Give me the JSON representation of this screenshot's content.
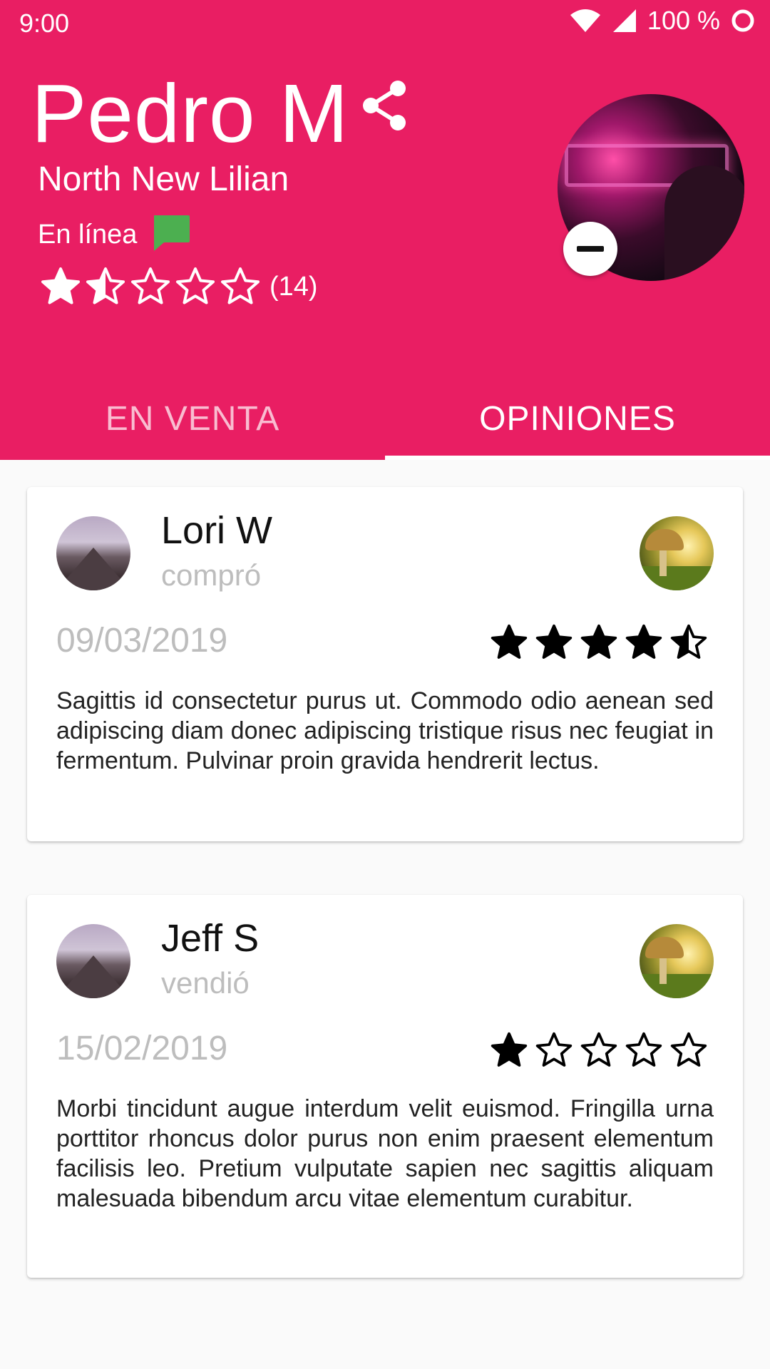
{
  "status_bar": {
    "time": "9:00",
    "battery_text": "100 %",
    "icons": [
      "wifi-icon",
      "cell-signal-icon",
      "battery-ring-icon"
    ]
  },
  "profile": {
    "name": "Pedro M",
    "location": "North New Lilian",
    "online_label": "En línea",
    "rating": 1.5,
    "rating_max": 5,
    "rating_count": "(14)",
    "icons": [
      "share-icon",
      "chat-icon",
      "remove-icon"
    ]
  },
  "tabs": [
    {
      "label": "EN VENTA",
      "active": false
    },
    {
      "label": "OPINIONES",
      "active": true
    }
  ],
  "reviews": [
    {
      "name": "Lori W",
      "action": "compró",
      "date": "09/03/2019",
      "rating": 4.5,
      "text": "Sagittis id consectetur purus ut. Commodo odio aenean sed adipiscing diam donec adipiscing tristique risus nec feugiat in fermentum. Pulvinar proin gravida hendrerit lectus."
    },
    {
      "name": "Jeff S",
      "action": "vendió",
      "date": "15/02/2019",
      "rating": 1,
      "text": "Morbi tincidunt augue interdum velit euismod. Fringilla urna porttitor rhoncus dolor purus non enim praesent elementum facilisis leo. Pretium vulputate sapien nec sagittis aliquam malesuada bibendum arcu vitae elementum curabitur."
    }
  ],
  "colors": {
    "primary": "#e91e63",
    "online_badge": "#4caf50",
    "muted_text": "#bdbdbd"
  }
}
